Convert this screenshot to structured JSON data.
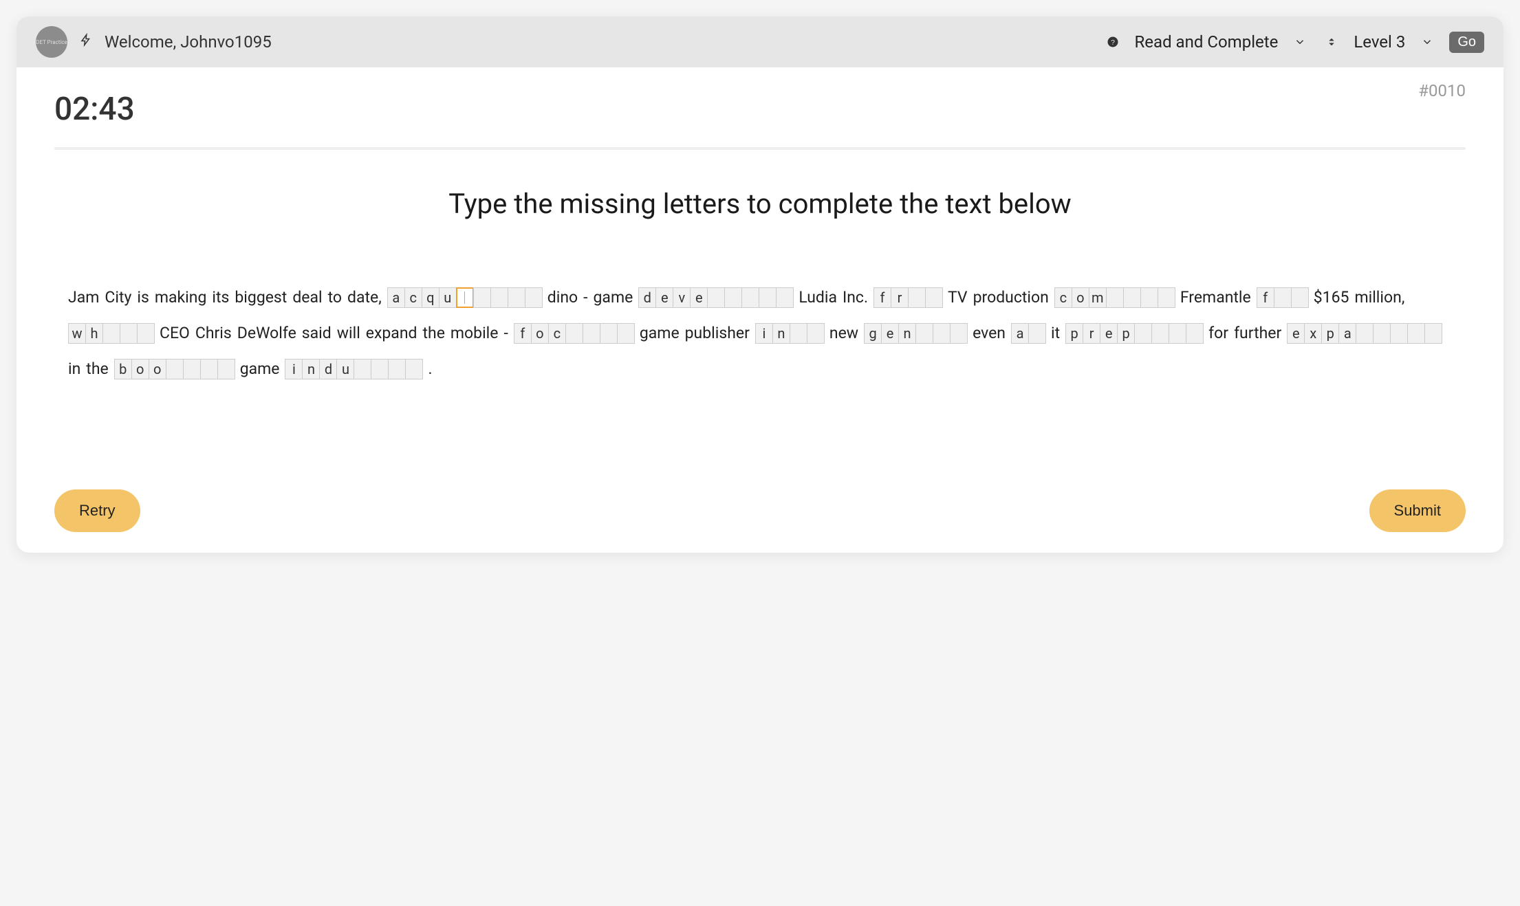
{
  "header": {
    "avatar_text": "DET Practice",
    "welcome": "Welcome, Johnvo1095",
    "mode_label": "Read and Complete",
    "level_label": "Level 3",
    "go_label": "Go"
  },
  "question_number": "#0010",
  "timer": "02:43",
  "prompt": "Type the missing letters to complete the text below",
  "segments": [
    {
      "type": "text",
      "value": "Jam City is making its biggest deal to date,"
    },
    {
      "type": "gap",
      "filled": [
        "a",
        "c",
        "q",
        "u"
      ],
      "blanks": 5,
      "active_index": 4
    },
    {
      "type": "text",
      "value": "dino - game"
    },
    {
      "type": "gap",
      "filled": [
        "d",
        "e",
        "v",
        "e"
      ],
      "blanks": 5
    },
    {
      "type": "text",
      "value": "Ludia Inc."
    },
    {
      "type": "gap",
      "filled": [
        "f",
        "r"
      ],
      "blanks": 2
    },
    {
      "type": "text",
      "value": "TV production"
    },
    {
      "type": "gap",
      "filled": [
        "c",
        "o",
        "m"
      ],
      "blanks": 4
    },
    {
      "type": "text",
      "value": "Fremantle"
    },
    {
      "type": "gap",
      "filled": [
        "f"
      ],
      "blanks": 2
    },
    {
      "type": "text",
      "value": "$165 million,"
    },
    {
      "type": "gap",
      "filled": [
        "w",
        "h"
      ],
      "blanks": 3
    },
    {
      "type": "text",
      "value": "CEO Chris DeWolfe said will expand the mobile -"
    },
    {
      "type": "gap",
      "filled": [
        "f",
        "o",
        "c"
      ],
      "blanks": 4
    },
    {
      "type": "text",
      "value": "game publisher"
    },
    {
      "type": "gap",
      "filled": [
        "i",
        "n"
      ],
      "blanks": 2
    },
    {
      "type": "text",
      "value": "new"
    },
    {
      "type": "gap",
      "filled": [
        "g",
        "e",
        "n"
      ],
      "blanks": 3
    },
    {
      "type": "text",
      "value": "even"
    },
    {
      "type": "gap",
      "filled": [
        "a"
      ],
      "blanks": 1
    },
    {
      "type": "text",
      "value": "it"
    },
    {
      "type": "gap",
      "filled": [
        "p",
        "r",
        "e",
        "p"
      ],
      "blanks": 4
    },
    {
      "type": "text",
      "value": "for further"
    },
    {
      "type": "gap",
      "filled": [
        "e",
        "x",
        "p",
        "a"
      ],
      "blanks": 5
    },
    {
      "type": "text",
      "value": "in the"
    },
    {
      "type": "gap",
      "filled": [
        "b",
        "o",
        "o"
      ],
      "blanks": 4
    },
    {
      "type": "text",
      "value": "game"
    },
    {
      "type": "gap",
      "filled": [
        "i",
        "n",
        "d",
        "u"
      ],
      "blanks": 4
    },
    {
      "type": "text",
      "value": "."
    }
  ],
  "buttons": {
    "retry": "Retry",
    "submit": "Submit"
  }
}
